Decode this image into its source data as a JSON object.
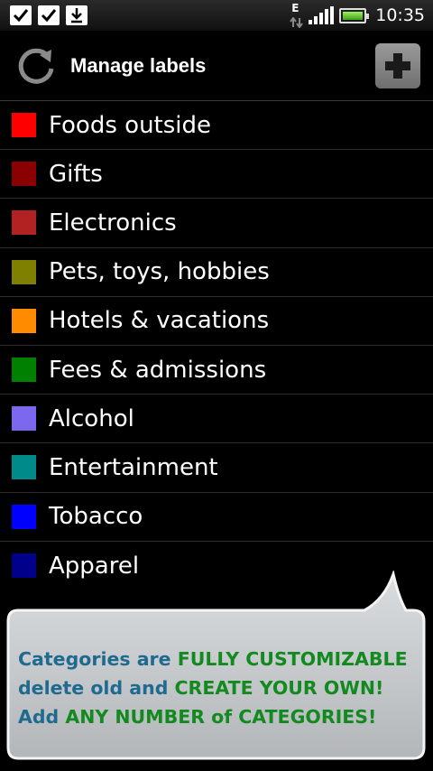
{
  "status_bar": {
    "notification_icons": [
      "checkbox-icon",
      "checkbox-icon",
      "download-icon"
    ],
    "network_type": "E",
    "time": "10:35"
  },
  "header": {
    "title": "Manage labels",
    "refresh_icon": "refresh-icon",
    "add_icon": "plus-icon"
  },
  "labels": [
    {
      "name": "Foods outside",
      "color": "#ff0000"
    },
    {
      "name": "Gifts",
      "color": "#8b0000"
    },
    {
      "name": "Electronics",
      "color": "#b22222"
    },
    {
      "name": "Pets, toys, hobbies",
      "color": "#808000"
    },
    {
      "name": "Hotels & vacations",
      "color": "#ff8c00"
    },
    {
      "name": "Fees & admissions",
      "color": "#008000"
    },
    {
      "name": "Alcohol",
      "color": "#7b68ee"
    },
    {
      "name": "Entertainment",
      "color": "#008b8b"
    },
    {
      "name": "Tobacco",
      "color": "#0000ff"
    },
    {
      "name": "Apparel",
      "color": "#00008b"
    }
  ],
  "promo": {
    "line1_a": "Categories are ",
    "line1_b": "FULLY CUSTOMIZABLE",
    "line2_a": "delete old and ",
    "line2_b": "CREATE YOUR OWN!",
    "line3_a": "Add ",
    "line3_b": "ANY NUMBER of CATEGORIES!"
  }
}
